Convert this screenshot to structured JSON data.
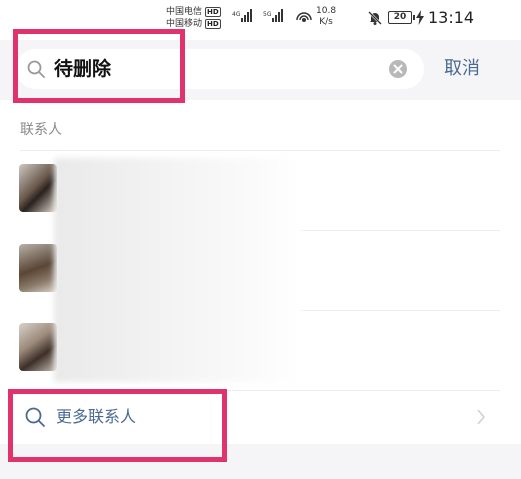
{
  "status_bar": {
    "carrier1": "中国电信",
    "carrier2": "中国移动",
    "hd_badge": "HD",
    "net1": "4G",
    "net2": "5G",
    "speed_value": "10.8",
    "speed_unit": "K/s",
    "battery": "20",
    "time": "13:14"
  },
  "search": {
    "query": "待删除",
    "cancel_label": "取消"
  },
  "section": {
    "contacts_header": "联系人"
  },
  "more": {
    "label": "更多联系人"
  },
  "colors": {
    "highlight": "#e0336b",
    "link": "#4a6a93",
    "search_bg": "#f5f5f7"
  },
  "icons": [
    "search-icon",
    "clear-icon",
    "chevron-right-icon",
    "bell-muted-icon",
    "battery-icon",
    "bolt-icon",
    "hotspot-icon"
  ]
}
